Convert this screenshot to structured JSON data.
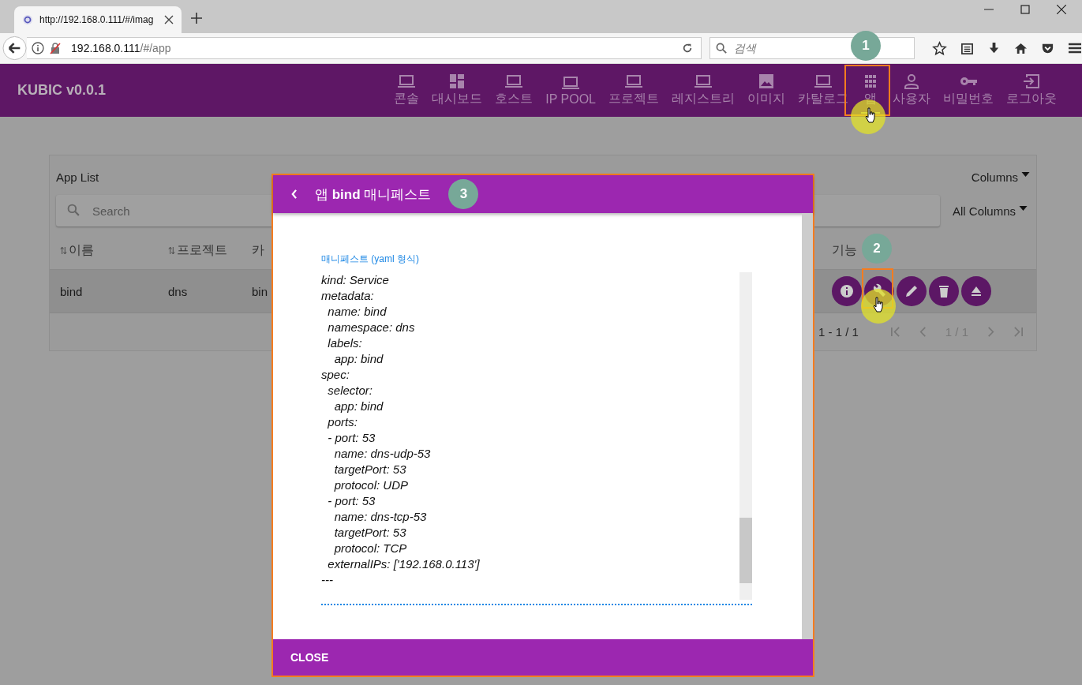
{
  "browser": {
    "tab_title": "http://192.168.0.111/#/imag",
    "url_host": "192.168.0.111",
    "url_path": "/#/app",
    "search_placeholder": "검색"
  },
  "app": {
    "brand": "KUBIC v0.0.1",
    "nav": [
      {
        "label": "콘솔",
        "kind": "laptop",
        "selected": false
      },
      {
        "label": "대시보드",
        "kind": "dashboard",
        "selected": false
      },
      {
        "label": "호스트",
        "kind": "laptop",
        "selected": false
      },
      {
        "label": "IP POOL",
        "kind": "laptop",
        "selected": false
      },
      {
        "label": "프로젝트",
        "kind": "laptop",
        "selected": false
      },
      {
        "label": "레지스트리",
        "kind": "laptop",
        "selected": false
      },
      {
        "label": "이미지",
        "kind": "image",
        "selected": false
      },
      {
        "label": "카탈로그",
        "kind": "laptop",
        "selected": false
      },
      {
        "label": "앱",
        "kind": "apps",
        "selected": true
      },
      {
        "label": "사용자",
        "kind": "person",
        "selected": false
      },
      {
        "label": "비밀번호",
        "kind": "key",
        "selected": false
      },
      {
        "label": "로그아웃",
        "kind": "logout",
        "selected": false
      }
    ]
  },
  "app_list": {
    "title": "App List",
    "columns_menu": "Columns",
    "search_placeholder": "Search",
    "filter": "All Columns",
    "columns": [
      {
        "label": "이름",
        "sortable": true
      },
      {
        "label": "프로젝트",
        "sortable": true
      },
      {
        "label": "카",
        "sortable": false
      },
      {
        "label": "기능",
        "sortable": false
      }
    ],
    "rows": [
      {
        "cells": [
          "bind",
          "dns",
          "bin"
        ],
        "actions": [
          {
            "kind": "info"
          },
          {
            "kind": "wrench"
          },
          {
            "kind": "pencil"
          },
          {
            "kind": "trash"
          },
          {
            "kind": "eject"
          }
        ]
      }
    ],
    "range": "1 - 1 / 1",
    "page": "1 / 1"
  },
  "dialog": {
    "title": "앱 **bind** 매니페스트",
    "field_label": "매니페스트 (yaml 형식)",
    "yaml": "kind: Service\nmetadata:\n  name: bind\n  namespace: dns\n  labels:\n    app: bind\nspec:\n  selector:\n    app: bind\n  ports:\n  - port: 53\n    name: dns-udp-53\n    targetPort: 53\n    protocol: UDP\n  - port: 53\n    name: dns-tcp-53\n    targetPort: 53\n    protocol: TCP\n  externalIPs: ['192.168.0.113']\n---",
    "close": "CLOSE"
  },
  "annotations": [
    "1",
    "2",
    "3"
  ]
}
